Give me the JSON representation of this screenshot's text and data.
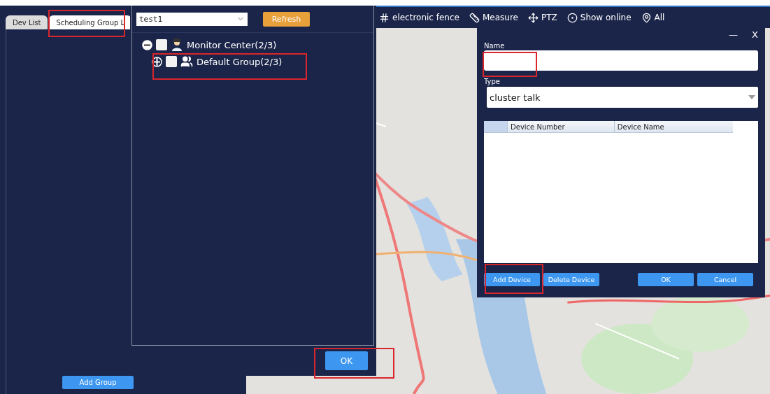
{
  "sidebar": {
    "tabs": [
      {
        "label": "Dev List",
        "selected": false
      },
      {
        "label": "Scheduling Group L",
        "selected": true
      }
    ],
    "add_group_button": "Add Group"
  },
  "group_picker": {
    "select_value": "test1",
    "refresh_button": "Refresh",
    "tree": [
      {
        "label": "Monitor Center(2/3)",
        "kind": "center",
        "checked": false,
        "expanded": true,
        "children": [
          {
            "label": "Default Group(2/3)",
            "kind": "group",
            "checked": false,
            "expanded": false
          }
        ]
      }
    ],
    "ok_button": "OK"
  },
  "map": {
    "toolbar": [
      {
        "kind": "fence",
        "label": "electronic fence"
      },
      {
        "kind": "measure",
        "label": "Measure"
      },
      {
        "kind": "ptz",
        "label": "PTZ"
      },
      {
        "kind": "online",
        "label": "Show online"
      },
      {
        "kind": "all",
        "label": "All"
      }
    ]
  },
  "dialog": {
    "minimize": "—",
    "close": "X",
    "name_label": "Name",
    "type_label": "Type",
    "type_value": "cluster talk",
    "columns": [
      "Device Number",
      "Device Name"
    ],
    "buttons": [
      {
        "label": "Add Device",
        "kind": "left"
      },
      {
        "label": "Delete Device",
        "kind": "left"
      },
      {
        "label": "OK",
        "kind": "right"
      },
      {
        "label": "Cancel",
        "kind": "right"
      }
    ]
  }
}
